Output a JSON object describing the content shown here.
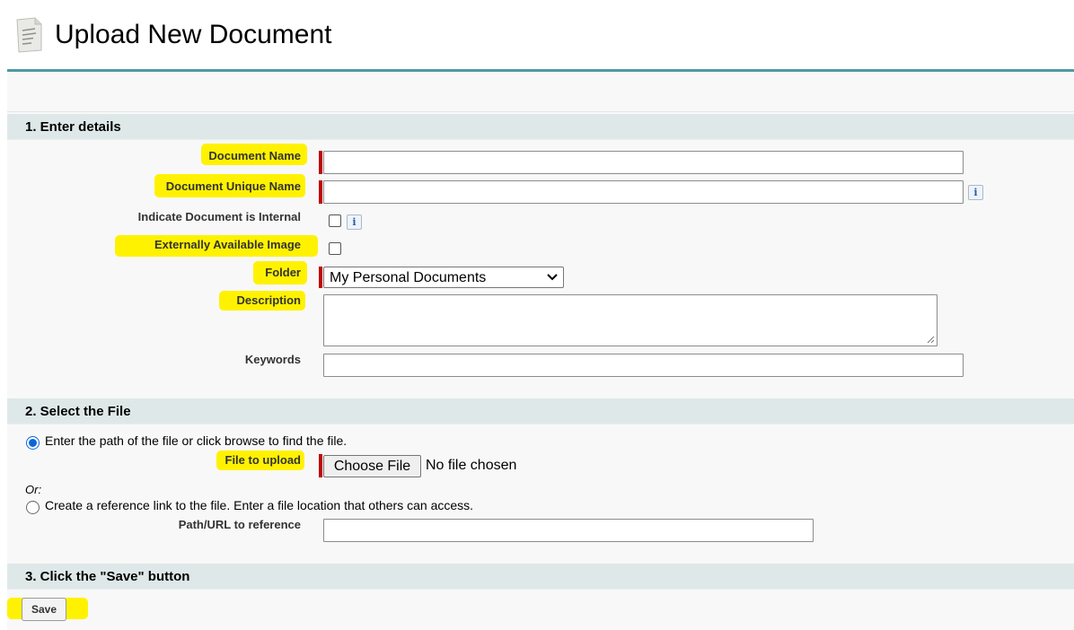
{
  "page": {
    "title": "Upload New Document",
    "icon": "document-icon"
  },
  "colors": {
    "accent_border": "#4d9aa3",
    "section_header_bg": "#dfe8e8",
    "required_marker": "#c00000",
    "highlight": "#fff200",
    "radio_selected": "#0a66d8"
  },
  "section1": {
    "header": "1. Enter details",
    "document_name_label": "Document Name",
    "document_name_value": "",
    "unique_name_label": "Document Unique Name",
    "unique_name_value": "",
    "internal_label": "Indicate Document is Internal",
    "internal_checked": false,
    "external_label": "Externally Available Image",
    "external_checked": false,
    "folder_label": "Folder",
    "folder_value": "My Personal Documents",
    "description_label": "Description",
    "description_value": "",
    "keywords_label": "Keywords",
    "keywords_value": "",
    "info_glyph": "i"
  },
  "section2": {
    "header": "2. Select the File",
    "option_browse": "Enter the path of the file or click browse to find the file.",
    "option_browse_selected": true,
    "file_label": "File to upload",
    "choose_file_button": "Choose File",
    "no_file_text": "No file chosen",
    "or_text": "Or:",
    "option_reference": "Create a reference link to the file. Enter a file location that others can access.",
    "option_reference_selected": false,
    "path_label": "Path/URL to reference",
    "path_value": ""
  },
  "section3": {
    "header": "3. Click the \"Save\" button",
    "save_button": "Save"
  }
}
